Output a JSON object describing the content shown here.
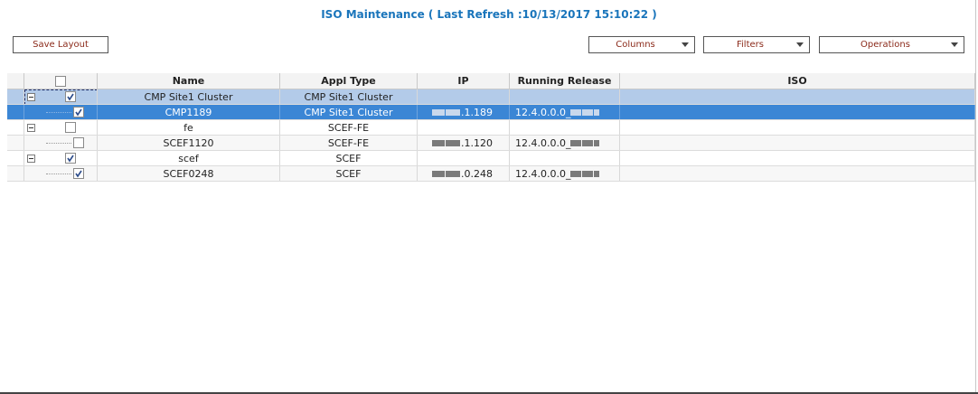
{
  "title": "ISO Maintenance ( Last Refresh :10/13/2017 15:10:22 )",
  "toolbar": {
    "save_layout": "Save Layout",
    "columns": "Columns",
    "filters": "Filters",
    "operations": "Operations"
  },
  "table": {
    "headers": [
      "Name",
      "Appl Type",
      "IP",
      "Running Release",
      "ISO"
    ],
    "rows": [
      {
        "name": "CMP Site1 Cluster",
        "type": "CMP Site1 Cluster",
        "ip_suffix": "",
        "release": "",
        "iso": "",
        "checked": true,
        "kind": "group"
      },
      {
        "name": "CMP1189",
        "type": "CMP Site1 Cluster",
        "ip_suffix": ".1.189",
        "release": "12.4.0.0.0_",
        "iso": "",
        "checked": true,
        "kind": "child"
      },
      {
        "name": "fe",
        "type": "SCEF-FE",
        "ip_suffix": "",
        "release": "",
        "iso": "",
        "checked": false,
        "kind": "group"
      },
      {
        "name": "SCEF1120",
        "type": "SCEF-FE",
        "ip_suffix": ".1.120",
        "release": "12.4.0.0.0_",
        "iso": "",
        "checked": false,
        "kind": "child"
      },
      {
        "name": "scef",
        "type": "SCEF",
        "ip_suffix": "",
        "release": "",
        "iso": "",
        "checked": true,
        "kind": "group"
      },
      {
        "name": "SCEF0248",
        "type": "SCEF",
        "ip_suffix": ".0.248",
        "release": "12.4.0.0.0_",
        "iso": "",
        "checked": true,
        "kind": "child"
      }
    ]
  },
  "colors": {
    "title": "#1a75bb",
    "button_text": "#8b2a1a",
    "cluster_row": "#b3cbe9",
    "selected_row": "#3b86d5"
  }
}
